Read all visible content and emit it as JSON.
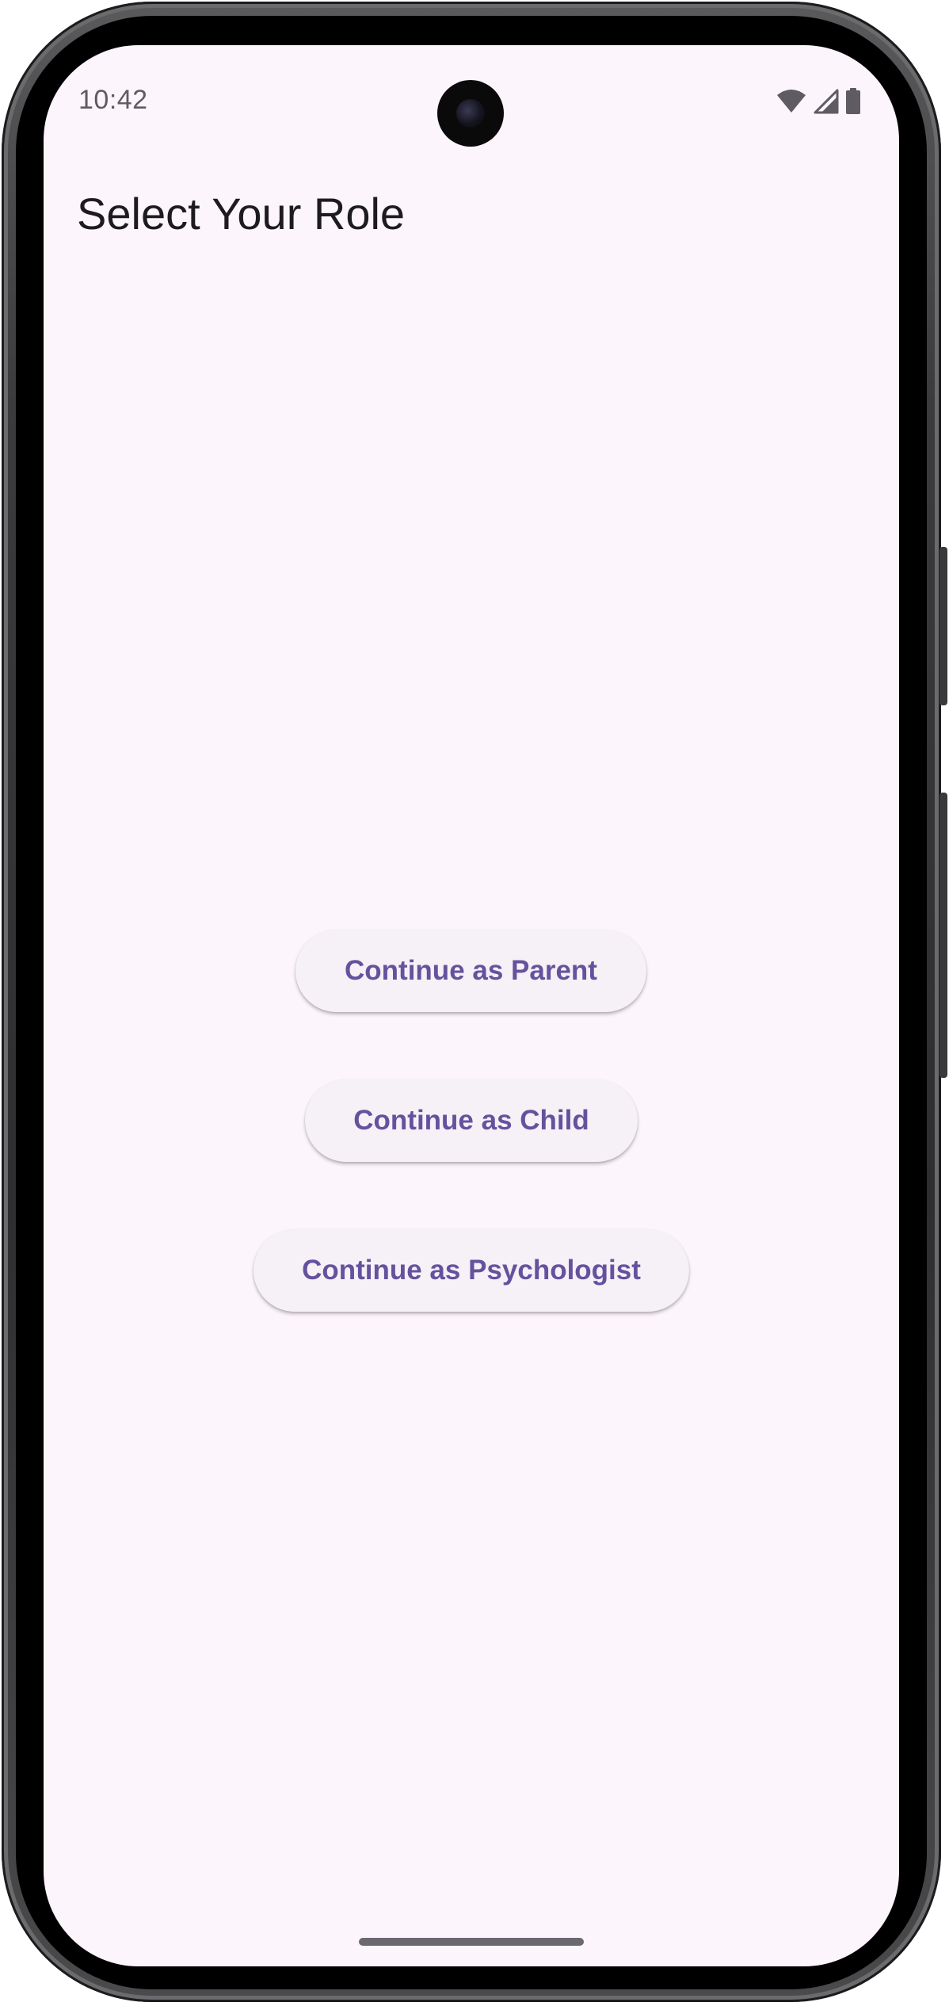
{
  "status_bar": {
    "time": "10:42",
    "icons": [
      "wifi-icon",
      "cellular-signal-icon",
      "battery-icon"
    ]
  },
  "app_bar": {
    "title": "Select Your Role"
  },
  "role_buttons": [
    {
      "label": "Continue as Parent"
    },
    {
      "label": "Continue as Child"
    },
    {
      "label": "Continue as Psychologist"
    }
  ],
  "colors": {
    "background": "#fcf5fc",
    "button_background": "#f5f1f6",
    "button_text": "#65529e",
    "title_text": "#1d1b20"
  }
}
